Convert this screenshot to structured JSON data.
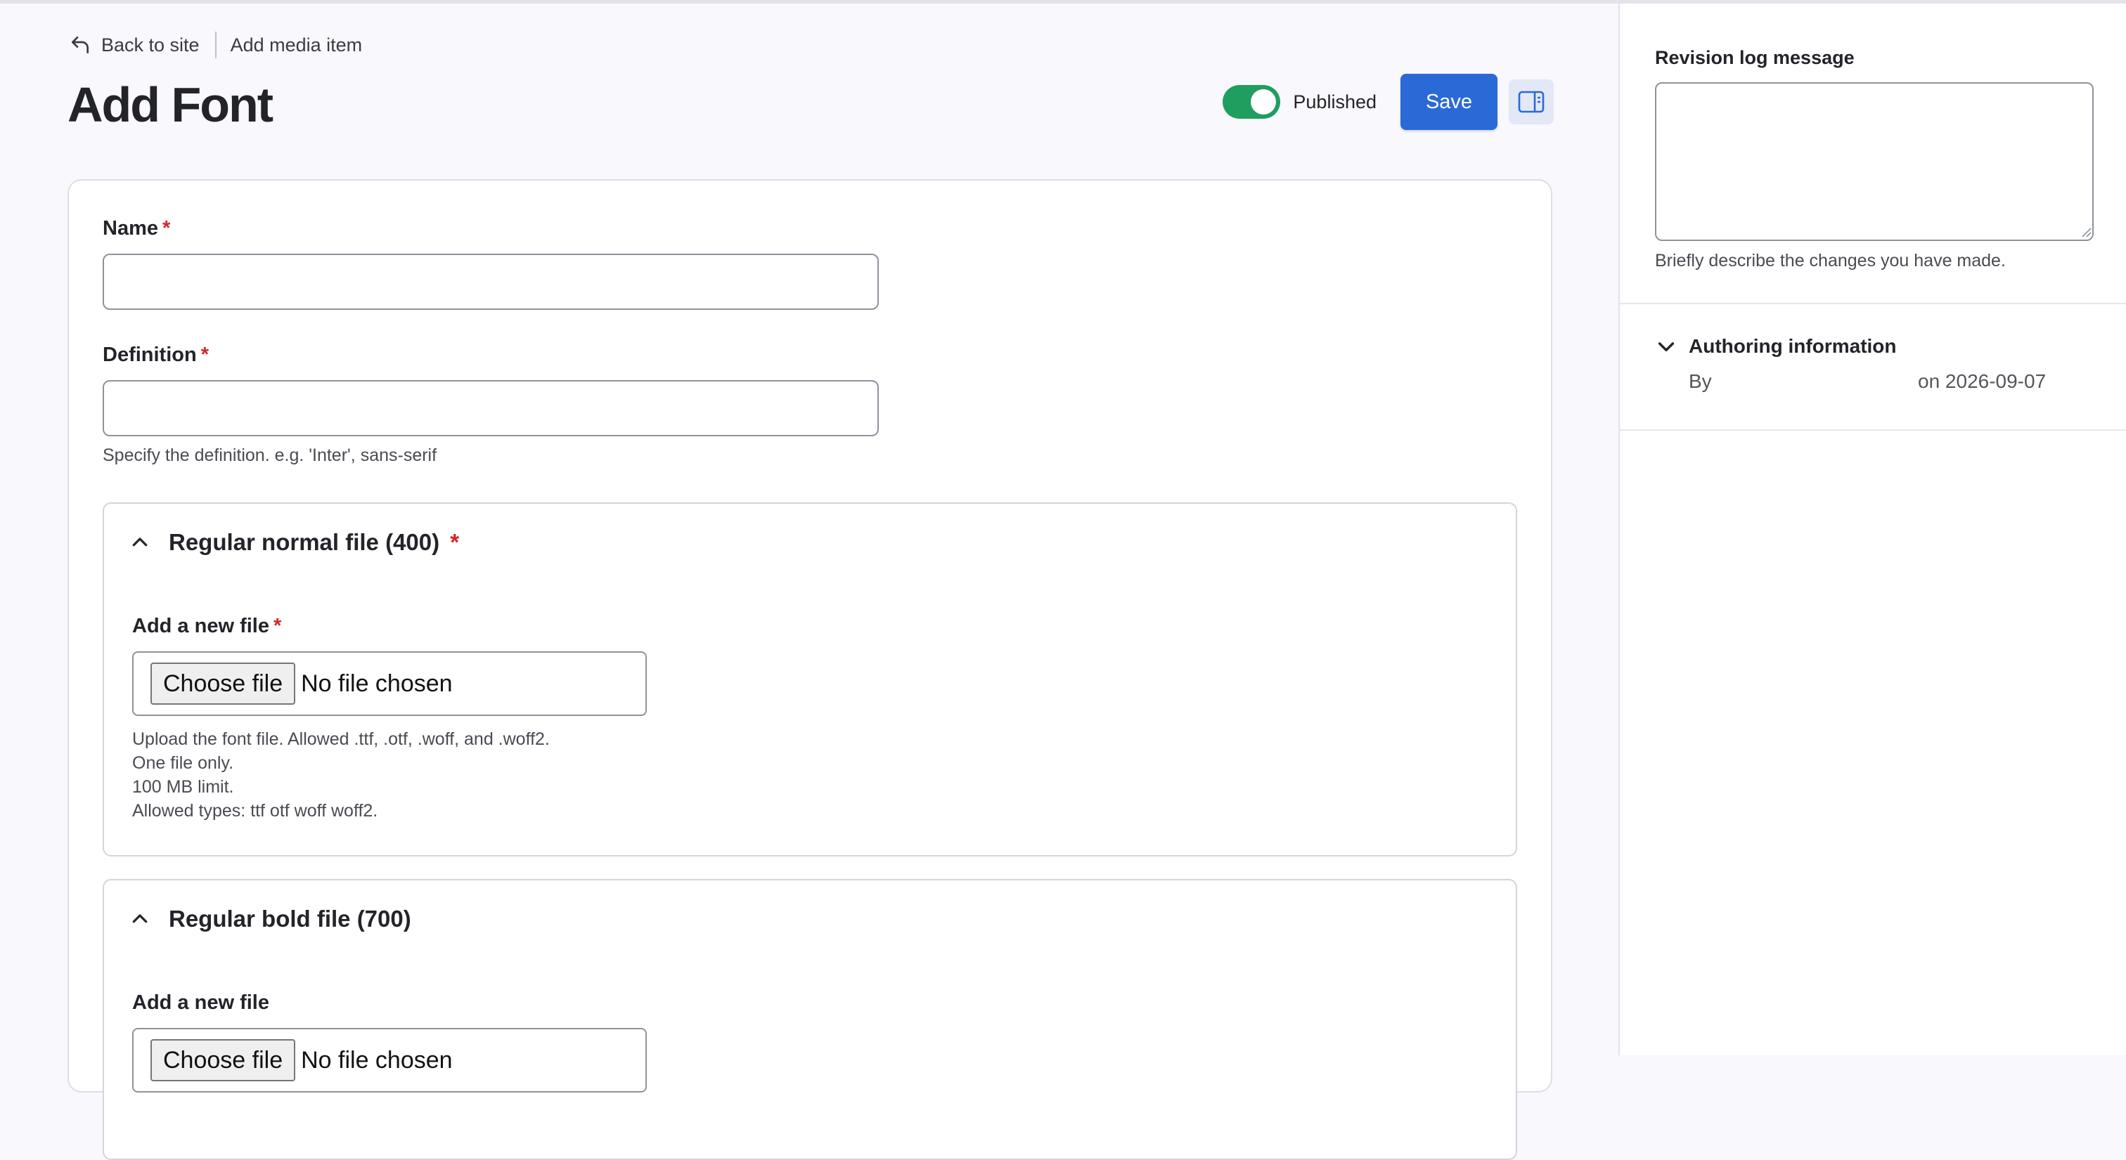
{
  "breadcrumbs": {
    "back_label": "Back to site",
    "current": "Add media item"
  },
  "page": {
    "title": "Add Font"
  },
  "actions": {
    "published_label": "Published",
    "published": true,
    "save_label": "Save"
  },
  "form": {
    "name": {
      "label": "Name",
      "required_mark": "*",
      "value": ""
    },
    "definition": {
      "label": "Definition",
      "required_mark": "*",
      "value": "",
      "description": "Specify the definition. e.g. 'Inter', sans-serif"
    },
    "regular_file": {
      "summary": "Regular normal file (400)",
      "required_mark": "*",
      "add_label": "Add a new file",
      "add_required_mark": "*",
      "choose_label": "Choose file",
      "no_file_label": "No file chosen",
      "help": [
        "Upload the font file. Allowed .ttf, .otf, .woff, and .woff2.",
        "One file only.",
        "100 MB limit.",
        "Allowed types: ttf otf woff woff2."
      ]
    },
    "bold_file": {
      "summary": "Regular bold file (700)",
      "add_label": "Add a new file",
      "choose_label": "Choose file",
      "no_file_label": "No file chosen"
    }
  },
  "sidebar": {
    "revision_label": "Revision log message",
    "revision_value": "",
    "revision_description": "Briefly describe the changes you have made.",
    "authoring_label": "Authoring information",
    "by_label": "By",
    "date_label": "on 2026-09-07"
  },
  "colors": {
    "accent": "#2a6ad6",
    "toggle_on": "#1f9e5f",
    "required": "#d0262a"
  }
}
